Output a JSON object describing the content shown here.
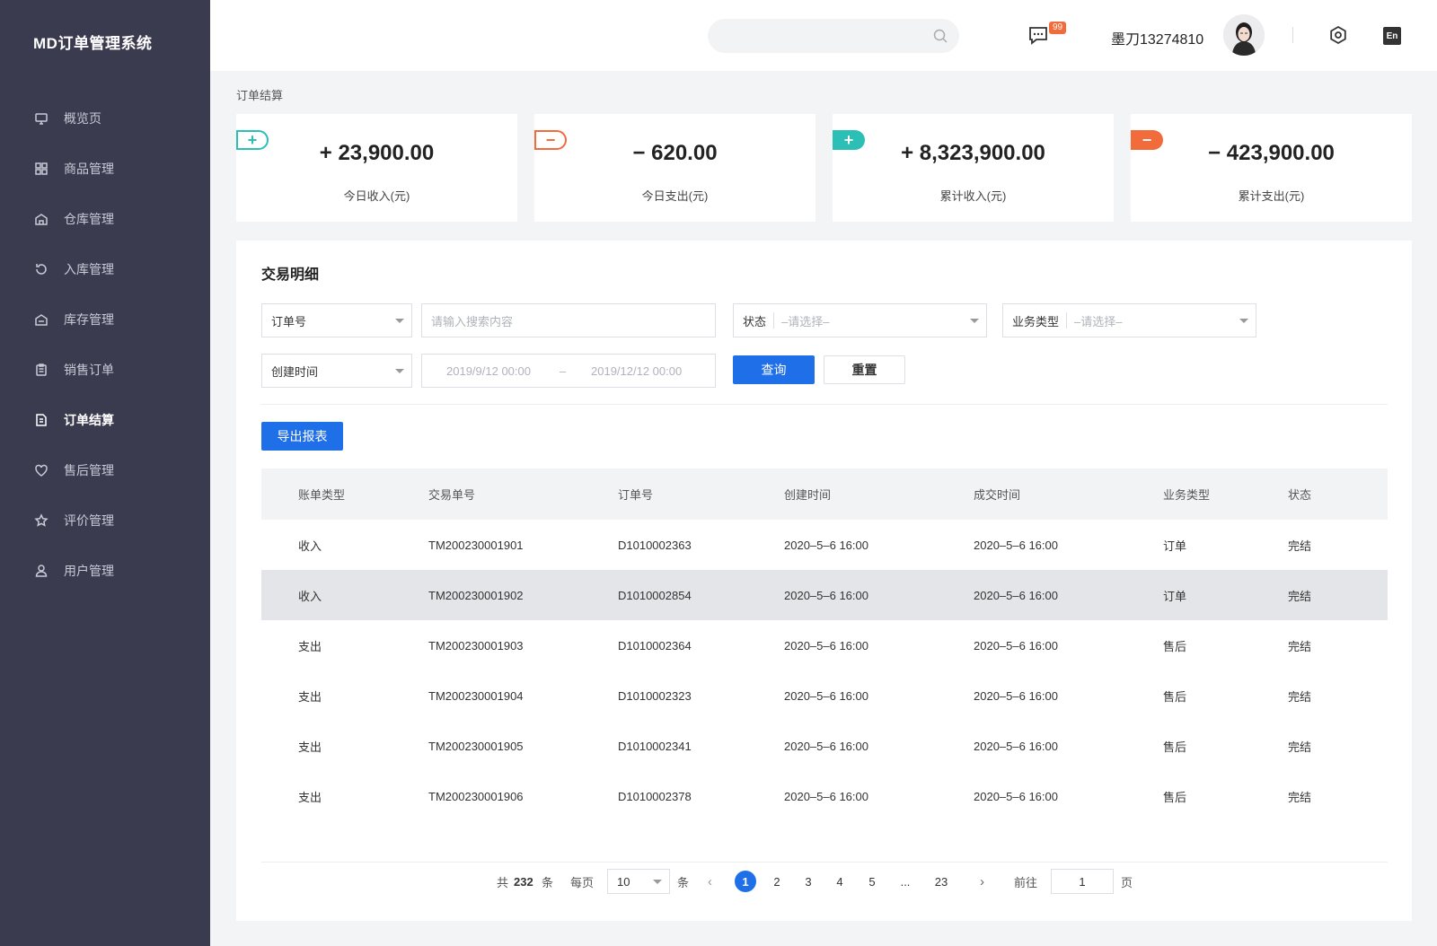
{
  "app": {
    "title": "MD订单管理系统"
  },
  "sidebar": {
    "items": [
      {
        "label": "概览页",
        "icon": "monitor-icon"
      },
      {
        "label": "商品管理",
        "icon": "grid-icon"
      },
      {
        "label": "仓库管理",
        "icon": "warehouse-icon"
      },
      {
        "label": "入库管理",
        "icon": "inbound-icon"
      },
      {
        "label": "库存管理",
        "icon": "inventory-icon"
      },
      {
        "label": "销售订单",
        "icon": "clipboard-icon"
      },
      {
        "label": "订单结算",
        "icon": "settlement-icon",
        "active": true
      },
      {
        "label": "售后管理",
        "icon": "heart-icon"
      },
      {
        "label": "评价管理",
        "icon": "star-icon"
      },
      {
        "label": "用户管理",
        "icon": "user-icon"
      }
    ]
  },
  "header": {
    "search_placeholder": "",
    "badge": "99",
    "username": "墨刀13274810",
    "lang": "En"
  },
  "breadcrumb": "订单结算",
  "stats": [
    {
      "sign": "+",
      "value": "+ 23,900.00",
      "label": "今日收入(元)",
      "color": "#2bbfb6",
      "style": "outline"
    },
    {
      "sign": "−",
      "value": "− 620.00",
      "label": "今日支出(元)",
      "color": "#f26b3a",
      "style": "outline"
    },
    {
      "sign": "+",
      "value": "+ 8,323,900.00",
      "label": "累计收入(元)",
      "color": "#2bbfb6",
      "style": "filled"
    },
    {
      "sign": "−",
      "value": "− 423,900.00",
      "label": "累计支出(元)",
      "color": "#f26b3a",
      "style": "filled"
    }
  ],
  "panel": {
    "title": "交易明细",
    "filters": {
      "field_select": "订单号",
      "search_placeholder": "请输入搜索内容",
      "status_label": "状态",
      "status_placeholder": "–请选择–",
      "biztype_label": "业务类型",
      "biztype_placeholder": "–请选择–",
      "time_select": "创建时间",
      "date_start": "2019/9/12 00:00",
      "date_sep": "–",
      "date_end": "2019/12/12 00:00",
      "query_label": "查询",
      "reset_label": "重置"
    },
    "export_label": "导出报表",
    "columns": [
      "账单类型",
      "交易单号",
      "订单号",
      "创建时间",
      "成交时间",
      "业务类型",
      "状态"
    ],
    "rows": [
      [
        "收入",
        "TM200230001901",
        "D1010002363",
        "2020–5–6  16:00",
        "2020–5–6  16:00",
        "订单",
        "完结"
      ],
      [
        "收入",
        "TM200230001902",
        "D1010002854",
        "2020–5–6  16:00",
        "2020–5–6  16:00",
        "订单",
        "完结"
      ],
      [
        "支出",
        "TM200230001903",
        "D1010002364",
        "2020–5–6  16:00",
        "2020–5–6  16:00",
        "售后",
        "完结"
      ],
      [
        "支出",
        "TM200230001904",
        "D1010002323",
        "2020–5–6  16:00",
        "2020–5–6  16:00",
        "售后",
        "完结"
      ],
      [
        "支出",
        "TM200230001905",
        "D1010002341",
        "2020–5–6  16:00",
        "2020–5–6  16:00",
        "售后",
        "完结"
      ],
      [
        "支出",
        "TM200230001906",
        "D1010002378",
        "2020–5–6  16:00",
        "2020–5–6  16:00",
        "售后",
        "完结"
      ]
    ],
    "pagination": {
      "total_prefix": "共",
      "total": "232",
      "total_suffix": "条",
      "per_page_label": "每页",
      "per_page": "10",
      "per_page_suffix": "条",
      "pages": [
        "1",
        "2",
        "3",
        "4",
        "5",
        "...",
        "23"
      ],
      "current": "1",
      "goto_label": "前往",
      "goto_value": "1",
      "goto_suffix": "页"
    }
  }
}
